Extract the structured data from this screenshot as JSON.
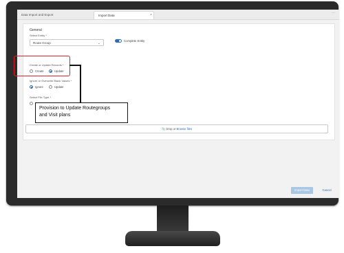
{
  "tabs": [
    {
      "label": "Data Import and Export"
    },
    {
      "label": "Import Data",
      "close_icon": "×"
    }
  ],
  "more_icon": "⋯",
  "general": {
    "title": "General",
    "select_entity_label": "Select Entity *",
    "select_entity_value": "Route Group",
    "complete_entity_label": "Complete Entity"
  },
  "create_update": {
    "label": "Create or Update Records *",
    "options": [
      "Create",
      "Update"
    ],
    "selected": "Update"
  },
  "ignore_overwrite": {
    "label": "Ignore or Overwrite Blank Values *",
    "options": [
      "Ignore",
      "Update"
    ],
    "selected": "Ignore"
  },
  "file_type": {
    "label": "Select File Type *",
    "partial_option": "E"
  },
  "dropzone": {
    "text": "Drop or",
    "browse": "Browse files"
  },
  "callout": {
    "line1": "Provision to Update Routegroups",
    "line2": "and Visit plans"
  },
  "footer": {
    "import_label": "Import Data",
    "cancel_label": "Cancel"
  },
  "colors": {
    "accent": "#2e6db4",
    "highlight": "#e0202a"
  }
}
